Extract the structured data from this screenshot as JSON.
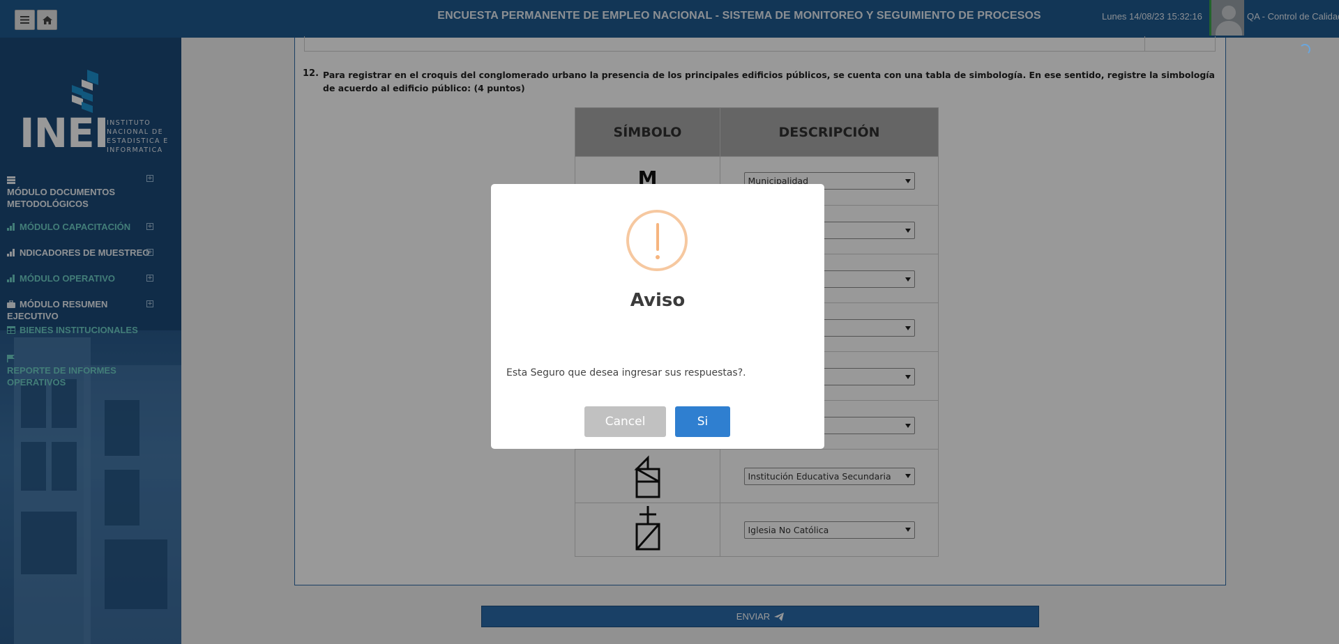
{
  "header": {
    "title": "ENCUESTA PERMANENTE DE EMPLEO NACIONAL - SISTEMA DE MONITOREO Y SEGUIMIENTO DE PROCESOS",
    "datetime": "Lunes 14/08/23 15:32:16",
    "user": "QA - Control de Calidad",
    "menu_icon": "hamburger-icon",
    "home_icon": "home-icon"
  },
  "sidebar": {
    "logo": {
      "name": "INEI",
      "subtitle": [
        "INSTITUTO",
        "NACIONAL DE",
        "ESTADISTICA E",
        "INFORMATICA"
      ]
    },
    "items": [
      {
        "label": "MÓDULO DOCUMENTOS METODOLÓGICOS",
        "icon": "database-icon",
        "expandable": true
      },
      {
        "label": "MÓDULO CAPACITACIÓN",
        "icon": "bar-chart-icon",
        "expandable": true
      },
      {
        "label": "NDICADORES DE MUESTREO",
        "icon": "bar-chart-icon",
        "expandable": true
      },
      {
        "label": "MÓDULO OPERATIVO",
        "icon": "bar-chart-icon",
        "expandable": true
      },
      {
        "label": "MÓDULO RESUMEN EJECUTIVO",
        "icon": "briefcase-icon",
        "expandable": true
      },
      {
        "label": "BIENES INSTITUCIONALES",
        "icon": "table-icon",
        "expandable": false
      },
      {
        "label": "REPORTE DE INFORMES OPERATIVOS",
        "icon": "flag-icon",
        "expandable": false
      }
    ],
    "colors": {
      "white": "#eef3f8",
      "teal": "#6fd0c8"
    }
  },
  "question": {
    "number": "12.",
    "text": "Para registrar en el croquis del conglomerado urbano la presencia de los principales edificios públicos, se cuenta con una tabla de simbología. En ese sentido, registre la simbología de acuerdo al edificio público: (4 puntos)"
  },
  "symbol_table": {
    "headers": [
      "SÍMBOLO",
      "DESCRIPCIÓN"
    ],
    "rows": [
      {
        "symbol": "M",
        "selected": "Municipalidad"
      },
      {
        "symbol": "",
        "selected": ""
      },
      {
        "symbol": "",
        "selected": ""
      },
      {
        "symbol": "",
        "selected": ""
      },
      {
        "symbol": "",
        "selected": ""
      },
      {
        "symbol": "",
        "selected": ""
      },
      {
        "symbol": "school-secondary-symbol",
        "selected": "Institución Educativa Secundaria"
      },
      {
        "symbol": "church-non-catholic-symbol",
        "selected": "Iglesia No Católica"
      }
    ]
  },
  "submit": {
    "label": "ENVIAR",
    "icon": "paper-plane-icon"
  },
  "dialog": {
    "icon": "warning-icon",
    "title": "Aviso",
    "message": "Esta Seguro que desea ingresar sus respuestas?.",
    "cancel_label": "Cancel",
    "confirm_label": "Si",
    "colors": {
      "warning": "#f6c8a0",
      "confirm": "#2f7fd0",
      "cancel": "#c1c1c1"
    }
  }
}
